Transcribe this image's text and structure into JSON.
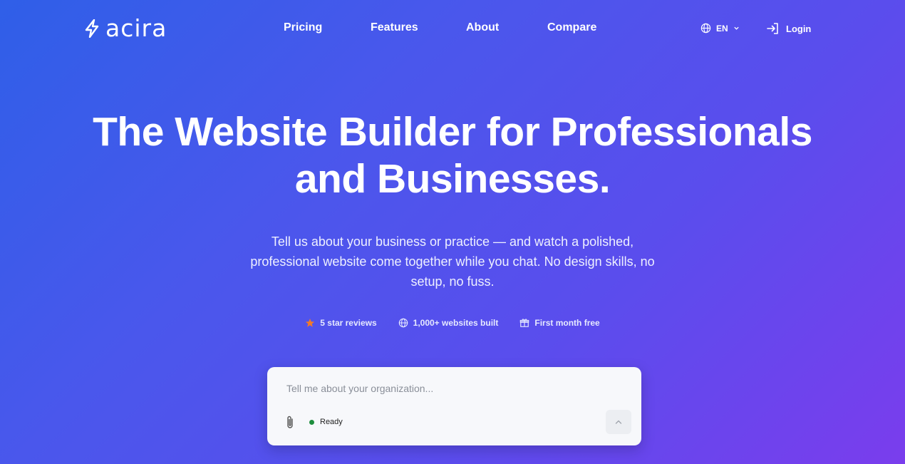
{
  "brand": {
    "name": "acira"
  },
  "nav": {
    "links": [
      "Pricing",
      "Features",
      "About",
      "Compare"
    ],
    "language": "EN",
    "login": "Login"
  },
  "hero": {
    "title_line1": "The Website Builder for Professionals",
    "title_line2": "and Businesses.",
    "subtitle": "Tell us about your business or practice — and watch a polished, professional website come together while you chat. No design skills, no setup, no fuss."
  },
  "badges": [
    {
      "icon": "star-icon",
      "label": "5 star reviews"
    },
    {
      "icon": "globe-icon",
      "label": "1,000+ websites built"
    },
    {
      "icon": "gift-icon",
      "label": "First month free"
    }
  ],
  "chat": {
    "placeholder": "Tell me about your organization...",
    "status": "Ready",
    "status_color": "#1e8e3e"
  },
  "colors": {
    "gradient_start": "#2f5fe8",
    "gradient_end": "#7a3ded",
    "star": "#f07a2a"
  }
}
